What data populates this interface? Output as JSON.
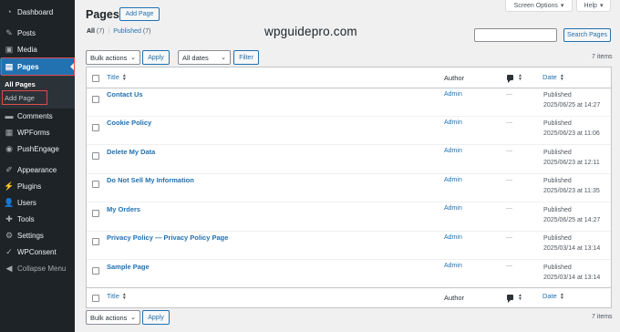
{
  "sidebar": {
    "items": [
      {
        "label": "Dashboard",
        "icon": "dashboard-icon",
        "glyph": "◔"
      },
      {
        "label": "Posts",
        "icon": "pin-icon",
        "glyph": "✎"
      },
      {
        "label": "Media",
        "icon": "media-icon",
        "glyph": "▣"
      },
      {
        "label": "Pages",
        "icon": "page-icon",
        "glyph": "▤"
      },
      {
        "label": "Comments",
        "icon": "comment-icon",
        "glyph": "▬"
      },
      {
        "label": "WPForms",
        "icon": "forms-icon",
        "glyph": "▦"
      },
      {
        "label": "PushEngage",
        "icon": "push-icon",
        "glyph": "◉"
      },
      {
        "label": "Appearance",
        "icon": "brush-icon",
        "glyph": "✐"
      },
      {
        "label": "Plugins",
        "icon": "plugin-icon",
        "glyph": "⚡"
      },
      {
        "label": "Users",
        "icon": "users-icon",
        "glyph": "👤"
      },
      {
        "label": "Tools",
        "icon": "wrench-icon",
        "glyph": "✚"
      },
      {
        "label": "Settings",
        "icon": "settings-icon",
        "glyph": "⚙"
      },
      {
        "label": "WPConsent",
        "icon": "consent-icon",
        "glyph": "✓"
      },
      {
        "label": "Collapse Menu",
        "icon": "collapse-icon",
        "glyph": "◀"
      }
    ],
    "submenu": {
      "all_pages": "All Pages",
      "add_page": "Add Page"
    }
  },
  "top": {
    "screen_options": "Screen Options",
    "help": "Help",
    "caret": "▾"
  },
  "header": {
    "title": "Pages",
    "add_new": "Add Page"
  },
  "filters": {
    "all_label": "All",
    "all_count": "(7)",
    "separator": "|",
    "published_label": "Published",
    "published_count": "(7)"
  },
  "watermark": "wpguidepro.com",
  "search": {
    "button": "Search Pages"
  },
  "tablenav": {
    "bulk_actions": "Bulk actions",
    "apply": "Apply",
    "dates": "All dates",
    "filter": "Filter",
    "items": "7 items",
    "chevron": "⌄"
  },
  "table": {
    "columns": {
      "title": "Title",
      "author": "Author",
      "date": "Date"
    },
    "sort_glyph": "▲▼",
    "rows": [
      {
        "title": "Contact Us",
        "author": "Admin",
        "comments": "—",
        "status": "Published",
        "date": "2025/06/25 at 14:27"
      },
      {
        "title": "Cookie Policy",
        "author": "Admin",
        "comments": "—",
        "status": "Published",
        "date": "2025/06/23 at 11:06"
      },
      {
        "title": "Delete My Data",
        "author": "Admin",
        "comments": "—",
        "status": "Published",
        "date": "2025/06/23 at 12:11"
      },
      {
        "title": "Do Not Sell My Information",
        "author": "Admin",
        "comments": "—",
        "status": "Published",
        "date": "2025/06/23 at 11:35"
      },
      {
        "title": "My Orders",
        "author": "Admin",
        "comments": "—",
        "status": "Published",
        "date": "2025/06/25 at 14:27"
      },
      {
        "title": "Privacy Policy — Privacy Policy Page",
        "author": "Admin",
        "comments": "—",
        "status": "Published",
        "date": "2025/03/14 at 13:14"
      },
      {
        "title": "Sample Page",
        "author": "Admin",
        "comments": "—",
        "status": "Published",
        "date": "2025/03/14 at 13:14"
      }
    ]
  },
  "colors": {
    "sidebar_bg": "#1d2327",
    "accent": "#2271b1",
    "highlight": "#e04b4b"
  }
}
